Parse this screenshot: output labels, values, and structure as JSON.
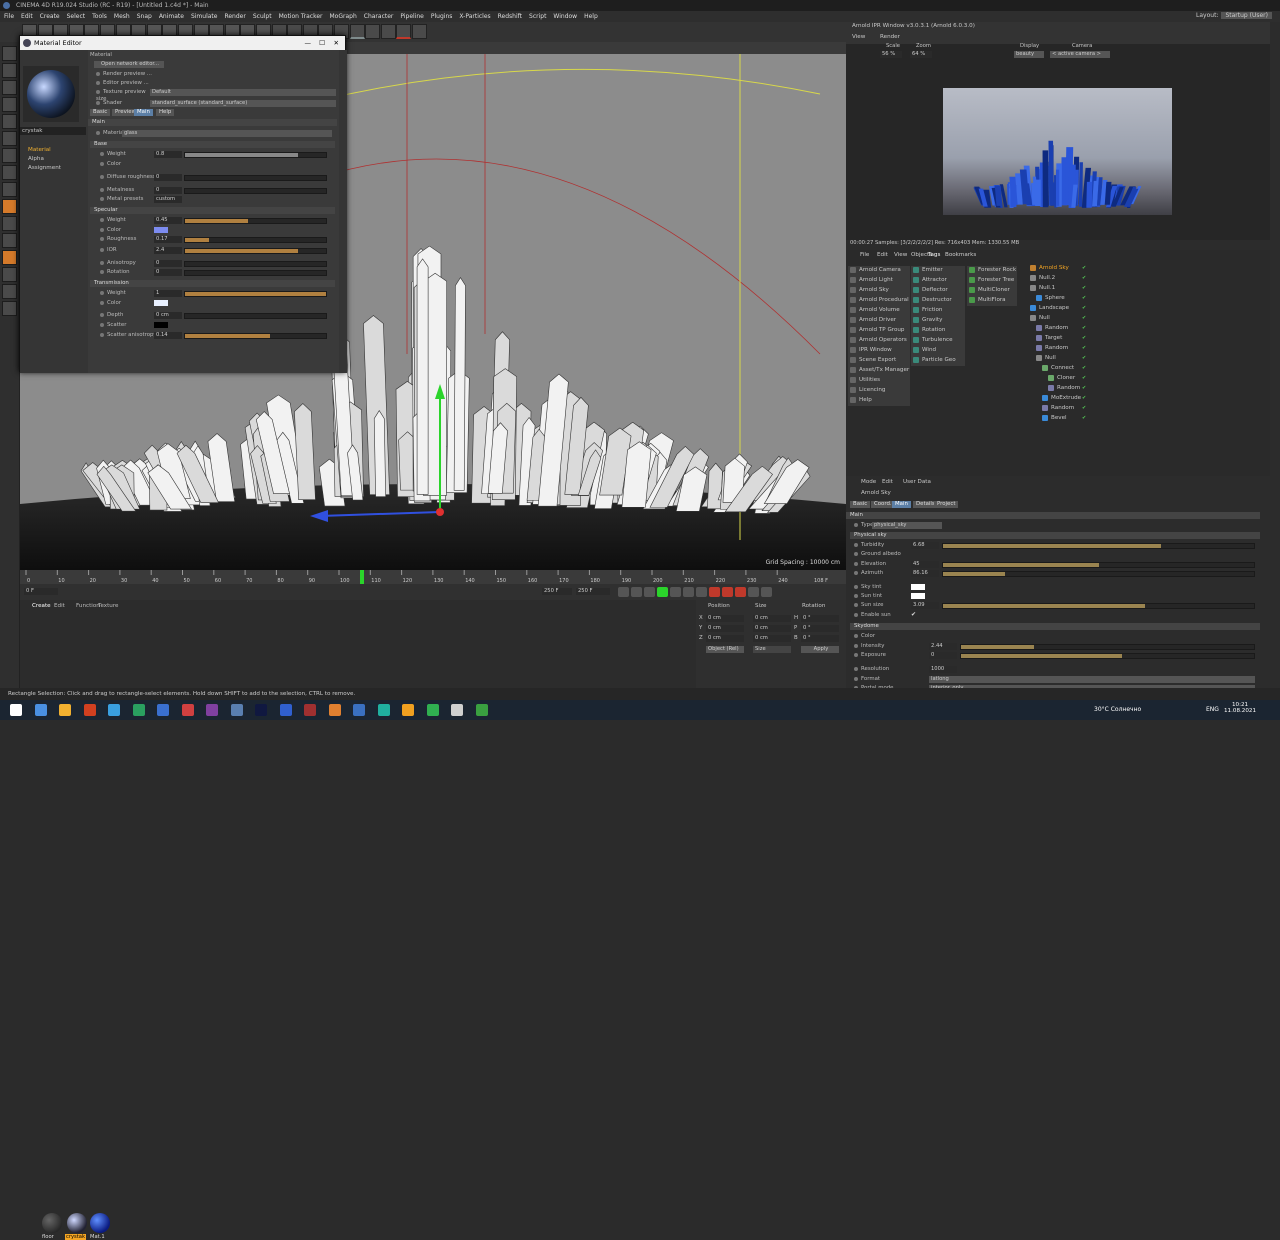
{
  "window": {
    "title": "CINEMA 4D R19.024 Studio (RC - R19) - [Untitled 1.c4d *] - Main"
  },
  "menu": [
    "File",
    "Edit",
    "Create",
    "Select",
    "Tools",
    "Mesh",
    "Snap",
    "Animate",
    "Simulate",
    "Render",
    "Sculpt",
    "Motion Tracker",
    "MoGraph",
    "Character",
    "Pipeline",
    "Plugins",
    "X-Particles",
    "Redshift",
    "Script",
    "Window",
    "Help"
  ],
  "layout": {
    "label": "Layout:",
    "value": "Startup (User)"
  },
  "material_editor": {
    "title": "Material Editor",
    "header_label": "Material",
    "open_network": "Open network editor...",
    "render_preview": "Render preview ...",
    "editor_preview": "Editor preview ...",
    "texture_preview_size": "Texture preview size",
    "texture_preview_value": "Default",
    "shader_label": "Shader",
    "shader_value": "standard_surface (standard_surface)",
    "name": "crystak",
    "channels": [
      "Material",
      "Alpha",
      "Assignment"
    ],
    "tabs": [
      "Basic",
      "Preview",
      "Main",
      "Help"
    ],
    "main_label": "Main",
    "material_label": "Material",
    "material_value": "glass",
    "base": {
      "label": "Base",
      "weight": "Weight",
      "weight_val": "0.8",
      "color": "Color",
      "diffuse_roughness": "Diffuse roughness",
      "diffuse_roughness_val": "0",
      "metalness": "Metalness",
      "metalness_val": "0",
      "metal_presets": "Metal presets",
      "metal_presets_val": "custom"
    },
    "specular": {
      "label": "Specular",
      "weight": "Weight",
      "weight_val": "0.45",
      "color": "Color",
      "roughness": "Roughness",
      "roughness_val": "0.17",
      "ior": "IOR",
      "ior_val": "2.4",
      "anisotropy": "Anisotropy",
      "anisotropy_val": "0",
      "rotation": "Rotation",
      "rotation_val": "0"
    },
    "transmission": {
      "label": "Transmission",
      "weight": "Weight",
      "weight_val": "1",
      "color": "Color",
      "depth": "Depth",
      "depth_val": "0 cm",
      "scatter": "Scatter",
      "scatter_anisotropy": "Scatter anisotropy",
      "scatter_anisotropy_val": "0.14"
    }
  },
  "viewport": {
    "grid_spacing": "Grid Spacing : 10000 cm"
  },
  "timeline": {
    "ticks": [
      "0",
      "10",
      "20",
      "30",
      "40",
      "50",
      "60",
      "70",
      "80",
      "90",
      "100",
      "110",
      "120",
      "130",
      "140",
      "150",
      "160",
      "170",
      "180",
      "190",
      "200",
      "210",
      "220",
      "230",
      "240"
    ],
    "end_frame": "108 F",
    "start": "0 F",
    "current": "0 F",
    "field_a": "250 F",
    "field_b": "250 F"
  },
  "material_manager": {
    "tabs": [
      "Create",
      "Edit",
      "Function",
      "Texture"
    ],
    "materials": [
      "floor",
      "crystak",
      "Mat.1"
    ]
  },
  "coordinates": {
    "headers": [
      "Position",
      "Size",
      "Rotation"
    ],
    "rows": [
      {
        "axis": "X",
        "pos": "0 cm",
        "size": "0 cm",
        "rot_axis": "H",
        "rot": "0 °"
      },
      {
        "axis": "Y",
        "pos": "0 cm",
        "size": "0 cm",
        "rot_axis": "P",
        "rot": "0 °"
      },
      {
        "axis": "Z",
        "pos": "0 cm",
        "size": "0 cm",
        "rot_axis": "B",
        "rot": "0 °"
      }
    ],
    "mode": "Object (Rel)",
    "size_mode": "Size",
    "apply": "Apply"
  },
  "ipr": {
    "title": "Arnold IPR Window v3.0.3.1 (Arnold 6.0.3.0)",
    "menu": [
      "View",
      "Render"
    ],
    "scale_label": "Scale",
    "scale_val": "56 %",
    "zoom_label": "Zoom",
    "zoom_val": "64 %",
    "display_label": "Display",
    "display_val": "beauty",
    "camera_label": "Camera",
    "camera_val": "< active camera >",
    "stats": "00:00:27  Samples: [3/2/2/2/2/2]  Res: 716x403  Mem: 1330.55 MB"
  },
  "objects": {
    "menu": [
      "File",
      "Edit",
      "View",
      "Objects",
      "Tags",
      "Bookmarks"
    ],
    "arnold_menu": [
      "Arnold Camera",
      "Arnold Light",
      "Arnold Sky",
      "Arnold Procedural",
      "Arnold Volume",
      "Arnold Driver",
      "Arnold TP Group",
      "Arnold Operators",
      "IPR Window",
      "Scene Export",
      "Asset/Tx Manager",
      "Utilities",
      "Licencing",
      "Help"
    ],
    "emitters": [
      "Emitter",
      "Attractor",
      "Deflector",
      "Destructor",
      "Friction",
      "Gravity",
      "Rotation",
      "Turbulence",
      "Wind",
      "Particle Geo"
    ],
    "forester": [
      "Forester Rock",
      "Forester Tree",
      "MultiCloner",
      "MultiFlora"
    ],
    "tree": [
      "Arnold Sky",
      "Null.2",
      "Null.1",
      "Sphere",
      "Landscape",
      "Null",
      "Random",
      "Target",
      "Random",
      "Null",
      "Connect",
      "Cloner",
      "Random",
      "MoExtrude",
      "Random",
      "Bevel"
    ]
  },
  "attributes": {
    "menu": [
      "Mode",
      "Edit",
      "User Data"
    ],
    "object_name": "Arnold Sky",
    "tabs": [
      "Basic",
      "Coord.",
      "Main",
      "Details",
      "Project"
    ],
    "main_label": "Main",
    "type_label": "Type",
    "type_val": "physical_sky",
    "physical_sky": "Physical sky",
    "turbidity": "Turbidity",
    "turbidity_val": "6.68",
    "ground_albedo": "Ground albedo",
    "elevation": "Elevation",
    "elevation_val": "45",
    "azimuth": "Azimuth",
    "azimuth_val": "86.16",
    "sky_tint": "Sky tint",
    "sun_tint": "Sun tint",
    "sun_size": "Sun size",
    "sun_size_val": "3.09",
    "enable_sun": "Enable sun",
    "skydome": "Skydome",
    "color": "Color",
    "intensity": "Intensity",
    "intensity_val": "2.44",
    "exposure": "Exposure",
    "exposure_val": "0",
    "resolution": "Resolution",
    "resolution_val": "1000",
    "format": "Format",
    "format_val": "latlong",
    "portal_mode": "Portal mode",
    "portal_mode_val": "interior_only"
  },
  "status": {
    "text": "Rectangle Selection: Click and drag to rectangle-select elements. Hold down SHIFT to add to the selection, CTRL to remove."
  },
  "taskbar": {
    "weather": "30°C Солнечно",
    "lang": "ENG",
    "time": "10:21",
    "date": "11.08.2021"
  },
  "colors": {
    "accent": "#5c7fa6",
    "selected_mat": "#f5a623",
    "crystal": "#ffffff"
  }
}
